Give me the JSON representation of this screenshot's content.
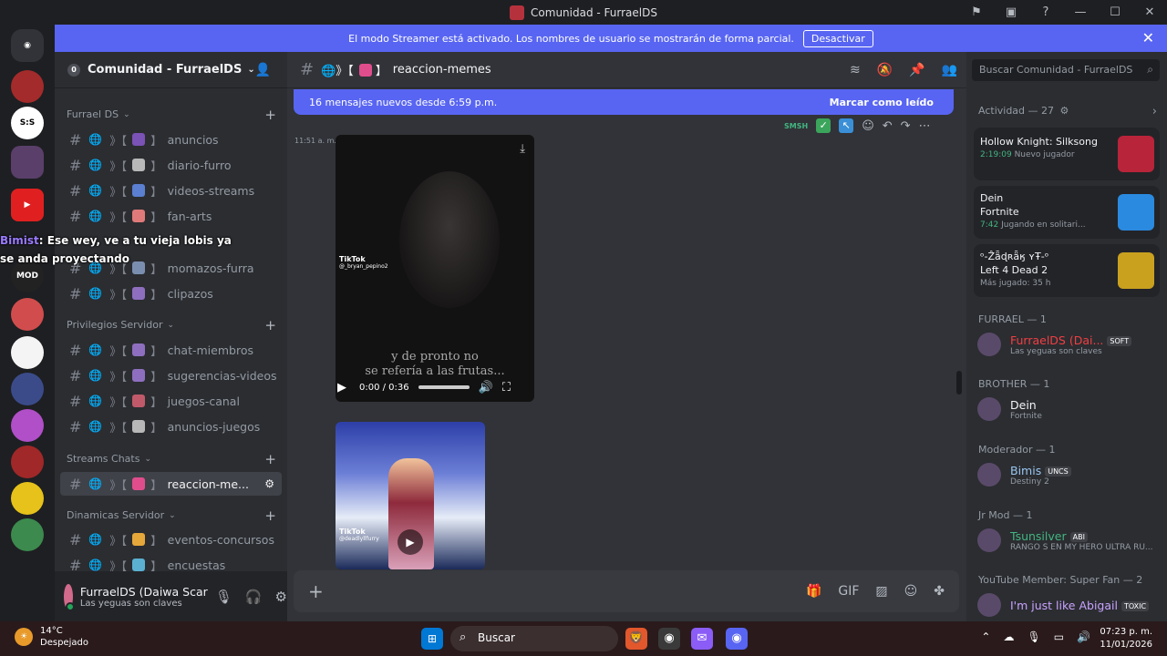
{
  "window": {
    "title": "Comunidad - FurraelDS"
  },
  "banner": {
    "text": "El modo Streamer está activado. Los nombres de usuario se mostrarán de forma parcial.",
    "button": "Desactivar"
  },
  "guild": {
    "name": "Comunidad - FurraelDS",
    "badge": "0"
  },
  "categories": [
    {
      "name": "Furrael DS",
      "channels": [
        {
          "name": "anuncios",
          "emoji_color": "#7b52b5"
        },
        {
          "name": "diario-furro",
          "emoji_color": "#b8b8b8"
        },
        {
          "name": "videos-streams",
          "emoji_color": "#5b7fd1"
        },
        {
          "name": "fan-arts",
          "emoji_color": "#e07a7a"
        },
        {
          "name": "momazos-furra",
          "emoji_color": "#7a8fb0"
        },
        {
          "name": "clipazos",
          "emoji_color": "#8e6fbf"
        }
      ]
    },
    {
      "name": "Privilegios Servidor",
      "channels": [
        {
          "name": "chat-miembros",
          "emoji_color": "#8e6fbf"
        },
        {
          "name": "sugerencias-videos",
          "emoji_color": "#8e6fbf"
        },
        {
          "name": "juegos-canal",
          "emoji_color": "#c05a6a"
        },
        {
          "name": "anuncios-juegos",
          "emoji_color": "#b8b8b8"
        }
      ]
    },
    {
      "name": "Streams Chats",
      "channels": [
        {
          "name": "reaccion-me...",
          "emoji_color": "#e04d8c"
        }
      ]
    },
    {
      "name": "Dinamicas Servidor",
      "channels": [
        {
          "name": "eventos-concursos",
          "emoji_color": "#e6a83a"
        },
        {
          "name": "encuestas",
          "emoji_color": "#5bb0d1"
        }
      ]
    }
  ],
  "user": {
    "name": "FurraelDS (Daiwa Scarl...",
    "status": "Las yeguas son claves"
  },
  "channel": {
    "name": "reaccion-memes"
  },
  "new_messages": {
    "text": "16 mensajes nuevos desde 6:59 p.m.",
    "mark": "Marcar como leído"
  },
  "message": {
    "time": "11:51 a. m."
  },
  "video": {
    "subtitle_1": "y de pronto no",
    "subtitle_2": "se refería a las frutas...",
    "time": "0:00 / 0:36",
    "tiktok": "TikTok",
    "tiktok_user": "@_bryan_pepino2",
    "tiktok2_user": "@deadlyllfurry"
  },
  "overlay": {
    "name": "Bimist",
    "text": ": Ese wey, ve a tu vieja lobis ya se anda proyectando"
  },
  "search": {
    "placeholder": "Buscar Comunidad - FurraelDS"
  },
  "activity": {
    "header": "Actividad — 27",
    "items": [
      {
        "user": "",
        "game": "Hollow Knight: Silksong",
        "time": "2:19:09",
        "detail": "Nuevo jugador",
        "color": "#b8243a"
      },
      {
        "user": "Dein",
        "game": "Fortnite",
        "time": "7:42",
        "detail": "Jugando en solitari...",
        "color": "#2a8ae0"
      },
      {
        "user": "ᵒ-Ẑǟɖʀǟӄ ʏŦ-ᵒ",
        "game": "Left 4 Dead 2",
        "time": "",
        "detail": "Más jugado: 35 h",
        "color": "#c9a11f"
      }
    ]
  },
  "groups": [
    {
      "header": "FURRAEL — 1",
      "name": "FurraelDS (Dai...",
      "tag": "SOFT",
      "sub": "Las yeguas son claves",
      "color": "#f23f43"
    },
    {
      "header": "BROTHER — 1",
      "name": "Dein",
      "tag": "",
      "sub": "Fortnite",
      "color": "#f2f3f5"
    },
    {
      "header": "Moderador — 1",
      "name": "Bimis",
      "tag": "UNCS",
      "sub": "Destiny 2",
      "color": "#9ac6f0"
    },
    {
      "header": "Jr Mod — 1",
      "name": "Tsunsilver",
      "tag": "ABI",
      "sub": "RANGO S EN MY HERO ULTRA RU...",
      "color": "#43b581"
    },
    {
      "header": "YouTube Member: Super Fan — 2",
      "name": "I'm just like Abigail",
      "tag": "TOXIC",
      "sub": "",
      "color": "#c9a3ff"
    }
  ],
  "taskbar": {
    "temp": "14°C",
    "weather": "Despejado",
    "search": "Buscar",
    "time": "07:23 p. m.",
    "date": "11/01/2026"
  }
}
